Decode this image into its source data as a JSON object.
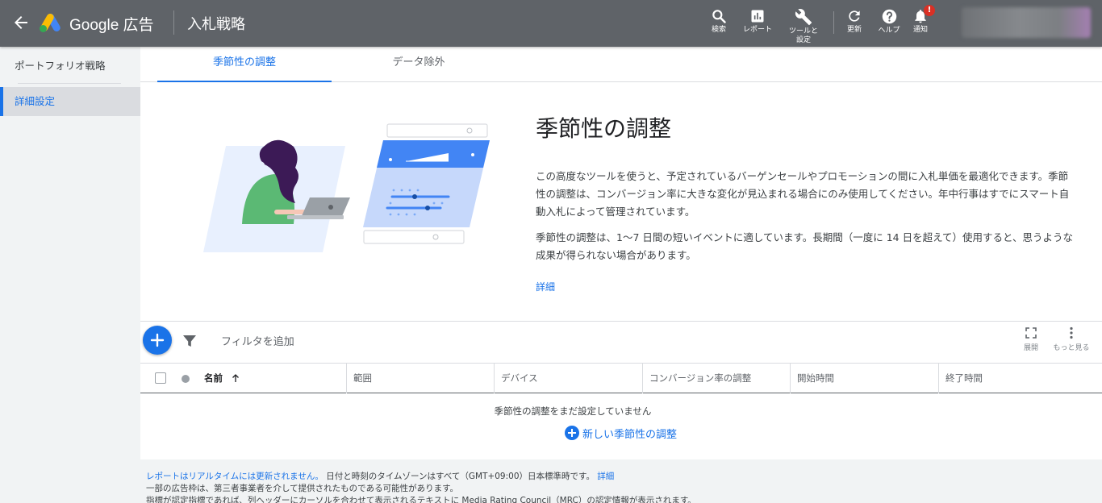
{
  "header": {
    "brand": "Google 広告",
    "page_title": "入札戦略",
    "tools": [
      {
        "icon": "search-icon",
        "label": "検索"
      },
      {
        "icon": "reports-icon",
        "label": "レポート"
      },
      {
        "icon": "wrench-icon",
        "label": "ツールと設定"
      },
      {
        "icon": "refresh-icon",
        "label": "更新"
      },
      {
        "icon": "help-icon",
        "label": "ヘルプ"
      },
      {
        "icon": "bell-icon",
        "label": "通知"
      }
    ],
    "notification_badge": "!"
  },
  "sidebar": {
    "items": [
      {
        "label": "ポートフォリオ戦略"
      },
      {
        "label": "詳細設定"
      }
    ]
  },
  "tabs": [
    {
      "label": "季節性の調整"
    },
    {
      "label": "データ除外"
    }
  ],
  "intro": {
    "title": "季節性の調整",
    "p1": "この高度なツールを使うと、予定されているバーゲンセールやプロモーションの間に入札単価を最適化できます。季節性の調整は、コンバージョン率に大きな変化が見込まれる場合にのみ使用してください。年中行事はすでにスマート自動入札によって管理されています。",
    "p2": "季節性の調整は、1〜7 日間の短いイベントに適しています。長期間（一度に 14 日を超えて）使用すると、思うような成果が得られない場合があります。",
    "link": "詳細"
  },
  "toolbar": {
    "filter_label": "フィルタを追加",
    "expand_label": "展開",
    "more_label": "もっと見る"
  },
  "table": {
    "columns": [
      "名前",
      "範囲",
      "デバイス",
      "コンバージョン率の調整",
      "開始時間",
      "終了時間"
    ],
    "empty_message": "季節性の調整をまだ設定していません",
    "new_label": "新しい季節性の調整"
  },
  "footer": {
    "line1_link": "レポートはリアルタイムには更新されません。",
    "line1_text": "日付と時刻のタイムゾーンはすべて（GMT+09:00）日本標準時です。",
    "line1_link2": "詳細",
    "line2": "一部の広告枠は、第三者事業者を介して提供されたものである可能性があります。",
    "line3": "指標が認定指標であれば、列ヘッダーにカーソルを合わせて表示されるテキストに Media Rating Council（MRC）の認定情報が表示されます。"
  },
  "colors": {
    "header_bg": "#5f6368",
    "accent": "#1a73e8",
    "badge": "#d93025"
  }
}
